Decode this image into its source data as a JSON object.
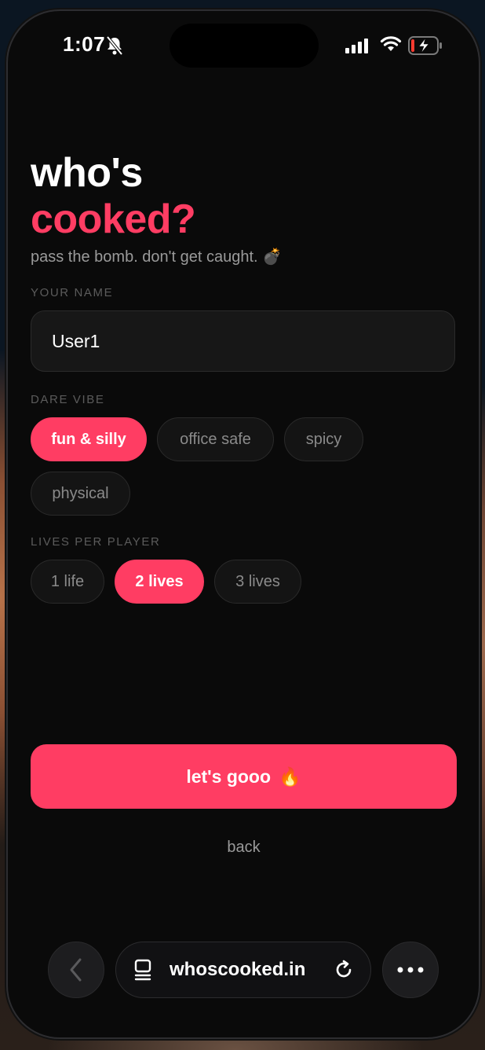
{
  "status_bar": {
    "time": "1:07",
    "icons": [
      "bell-slash-icon",
      "cellular-signal-icon",
      "wifi-icon",
      "battery-charging-icon"
    ]
  },
  "header": {
    "title_line1": "who's",
    "title_line2": "cooked?",
    "tagline": "pass the bomb. don't get caught. 💣"
  },
  "form": {
    "name_label": "YOUR NAME",
    "name_value": "User1",
    "vibe_label": "DARE VIBE",
    "vibe_options": [
      {
        "label": "fun & silly",
        "selected": true
      },
      {
        "label": "office safe",
        "selected": false
      },
      {
        "label": "spicy",
        "selected": false
      },
      {
        "label": "physical",
        "selected": false
      }
    ],
    "lives_label": "LIVES PER PLAYER",
    "lives_options": [
      {
        "label": "1 life",
        "selected": false
      },
      {
        "label": "2 lives",
        "selected": true
      },
      {
        "label": "3 lives",
        "selected": false
      }
    ]
  },
  "actions": {
    "primary_label": "let's gooo",
    "primary_emoji": "🔥",
    "back_label": "back"
  },
  "browser": {
    "url": "whoscooked.in",
    "icons": [
      "chevron-left-icon",
      "tabs-icon",
      "reload-icon",
      "more-icon"
    ]
  },
  "colors": {
    "accent": "#ff3d63",
    "background": "#0a0a0a",
    "chip_background": "#141414"
  }
}
